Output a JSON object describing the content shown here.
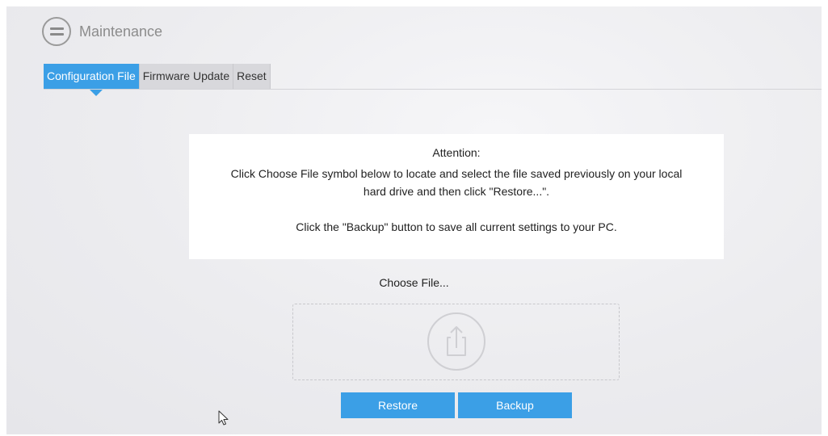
{
  "header": {
    "title": "Maintenance",
    "menu_icon": "menu-icon"
  },
  "tabs": [
    {
      "label": "Configuration File",
      "active": true
    },
    {
      "label": "Firmware Update",
      "active": false
    },
    {
      "label": "Reset",
      "active": false
    }
  ],
  "attention": {
    "title": "Attention:",
    "line1": "Click Choose File symbol below to locate and select the file saved previously on your local",
    "line1b": "hard drive and then click \"Restore...\".",
    "line2": "Click the \"Backup\" button to save all current settings to your PC."
  },
  "file": {
    "choose_label": "Choose File...",
    "upload_icon": "upload-icon"
  },
  "buttons": {
    "restore_label": "Restore",
    "backup_label": "Backup"
  },
  "colors": {
    "accent": "#3b9fe6",
    "tab_inactive": "#d8d8dc",
    "background": "#ececef"
  }
}
